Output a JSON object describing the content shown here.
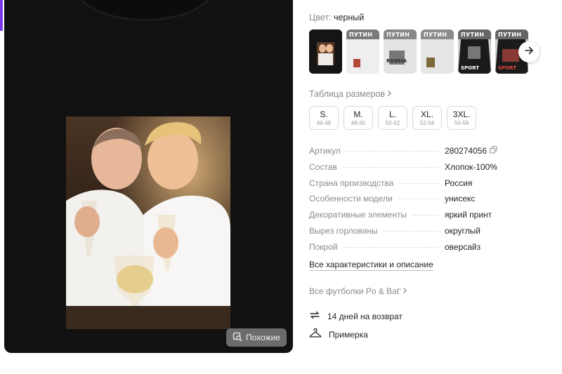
{
  "image_panel": {
    "similar_button_label": "Похожие",
    "icons": {
      "similar": "image-search-icon"
    }
  },
  "color": {
    "label": "Цвет:",
    "value": "черный"
  },
  "swatches": [
    {
      "caption": "",
      "bottom_caption": "",
      "selected": true
    },
    {
      "caption": "ПУТИН",
      "bottom_caption": "",
      "selected": false
    },
    {
      "caption": "ПУТИН",
      "bottom_caption": "RUSSIA",
      "selected": false
    },
    {
      "caption": "ПУТИН",
      "bottom_caption": "",
      "selected": false
    },
    {
      "caption": "ПУТИН",
      "bottom_caption": "SPORT",
      "selected": false
    },
    {
      "caption": "ПУТИН",
      "bottom_caption": "SPORT",
      "selected": false
    }
  ],
  "size_table_label": "Таблица размеров",
  "sizes": [
    {
      "label": "S.",
      "range": "46-48"
    },
    {
      "label": "M.",
      "range": "48-50"
    },
    {
      "label": "L.",
      "range": "50-52"
    },
    {
      "label": "XL.",
      "range": "52-54"
    },
    {
      "label": "3XL.",
      "range": "56-58"
    }
  ],
  "specs": [
    {
      "key": "Артикул",
      "value": "280274056",
      "copyable": true
    },
    {
      "key": "Состав",
      "value": "Хлопок-100%"
    },
    {
      "key": "Страна производства",
      "value": "Россия"
    },
    {
      "key": "Особенности модели",
      "value": "унисекс"
    },
    {
      "key": "Декоративные элементы",
      "value": "яркий принт"
    },
    {
      "key": "Вырез горловины",
      "value": "округлый"
    },
    {
      "key": "Покрой",
      "value": "оверсайз"
    }
  ],
  "all_specs_link": "Все характеристики и описание",
  "brand_link": "Все футболки Po & Bat'",
  "features": [
    {
      "label": "14 дней на возврат",
      "icon": "return-arrows-icon"
    },
    {
      "label": "Примерка",
      "icon": "hanger-icon"
    }
  ],
  "colors": {
    "accent": "#9b4de0",
    "panel": "#111111",
    "muted_text": "#8a8a8a"
  }
}
